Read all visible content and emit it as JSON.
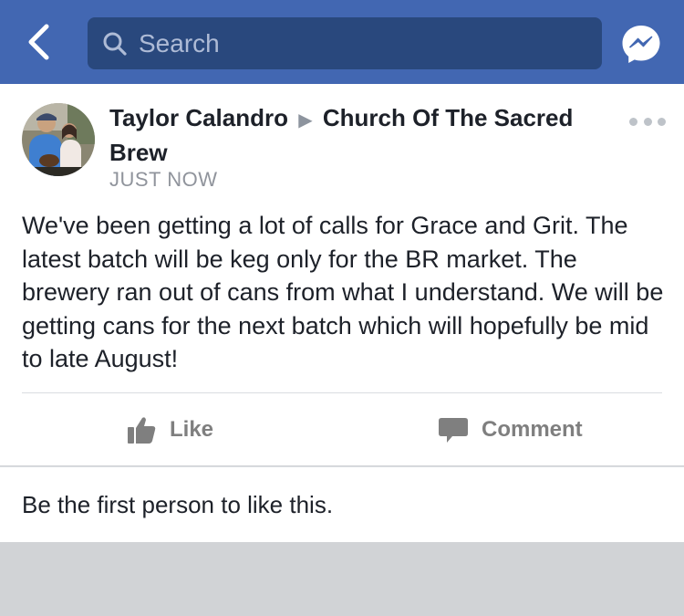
{
  "colors": {
    "brand_blue": "#4267b2",
    "search_bg": "#29487d",
    "feed_bg": "#d1d3d6",
    "action_gray": "#7f7f7f",
    "text_dark": "#1d2129",
    "meta_gray": "#90949c"
  },
  "nav": {
    "back_icon": "chevron-left-icon",
    "search_placeholder": "Search",
    "messenger_icon": "messenger-icon"
  },
  "post": {
    "author": "Taylor Calandro",
    "separator_icon": "triangle-right-icon",
    "group": "Church Of The Sacred Brew",
    "timestamp": "JUST NOW",
    "body": "We've been getting a lot of calls for Grace and Grit. The latest batch will be keg only for the BR market. The brewery ran out of cans from what I understand. We will be getting cans for the next batch which will hopefully be mid to late August!",
    "actions": {
      "like_label": "Like",
      "comment_label": "Comment"
    },
    "likes_summary": "Be the first person to like this."
  }
}
